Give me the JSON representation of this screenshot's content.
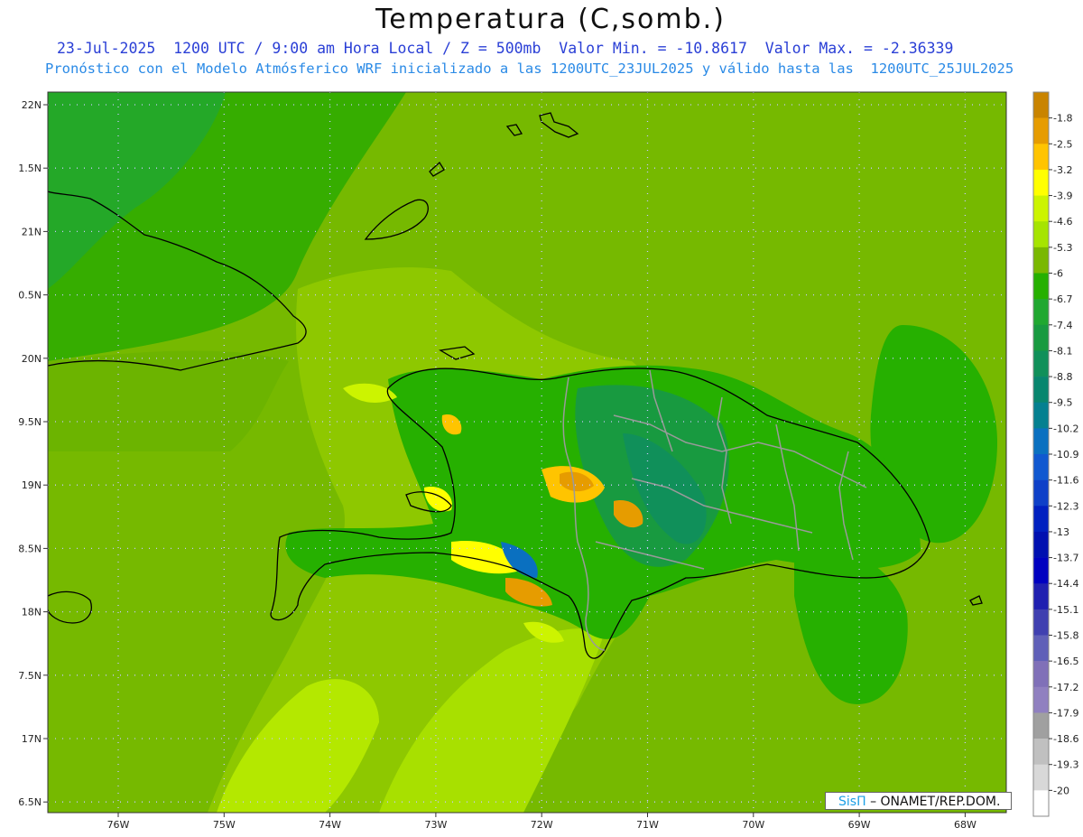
{
  "title": "Temperatura (C,somb.)",
  "subtitle_line1": "23-Jul-2025  1200 UTC / 9:00 am Hora Local / Z = 500mb  Valor Min. = -10.8617  Valor Max. = -2.36339",
  "subtitle_line2": "Pronóstico con el Modelo Atmósferico WRF inicializado a las 1200UTC_23JUL2025 y válido hasta las  1200UTC_25JUL2025",
  "credit": {
    "brand": "SisΠ",
    "text": "– ONAMET/REP.DOM."
  },
  "lat_labels": [
    "22N",
    "1.5N",
    "21N",
    "0.5N",
    "20N",
    "9.5N",
    "19N",
    "8.5N",
    "18N",
    "7.5N",
    "17N",
    "6.5N"
  ],
  "lon_labels": [
    "76W",
    "75W",
    "74W",
    "73W",
    "72W",
    "71W",
    "70W",
    "69W",
    "68W"
  ],
  "colorbar": {
    "labels": [
      "-1.8",
      "-2.5",
      "-3.2",
      "-3.9",
      "-4.6",
      "-5.3",
      "-6",
      "-6.7",
      "-7.4",
      "-8.1",
      "-8.8",
      "-9.5",
      "-10.2",
      "-10.9",
      "-11.6",
      "-12.3",
      "-13",
      "-13.7",
      "-14.4",
      "-15.1",
      "-15.8",
      "-16.5",
      "-17.2",
      "-17.9",
      "-18.6",
      "-19.3",
      "-20"
    ],
    "colors": [
      "#c98400",
      "#e69c00",
      "#ffc400",
      "#ffff00",
      "#ccf400",
      "#a6e400",
      "#7ab800",
      "#26b000",
      "#20a830",
      "#189a40",
      "#10905a",
      "#08866e",
      "#048090",
      "#0a70c0",
      "#1058d0",
      "#0e40c8",
      "#0020c0",
      "#0010b0",
      "#0000c0",
      "#2020b0",
      "#4040b0",
      "#6060b8",
      "#8070b8",
      "#9080c0",
      "#a0a0a0",
      "#c0c0c0",
      "#d8d8d8",
      "#ffffff"
    ]
  },
  "colors": {
    "title_blue": "#2a3fd6",
    "sub_blue": "#2a8ae6",
    "grid": "#c8c8ff"
  }
}
